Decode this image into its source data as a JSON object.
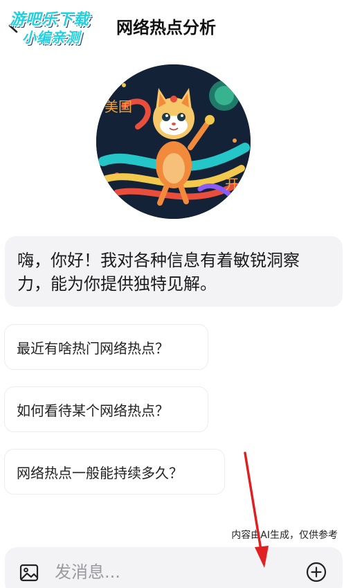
{
  "header": {
    "title": "网络热点分析",
    "back_icon": "chevron-left-icon",
    "watermark": {
      "line1": "游吧乐下载",
      "line2": "小编亲测"
    }
  },
  "avatar": {
    "description_icon": "cat-mascot-avatar",
    "text_left": "美国",
    "text_right": "开"
  },
  "greeting": {
    "text": "嗨，你好！我对各种信息有着敏锐洞察力，能为你提供独特见解。"
  },
  "suggestions": [
    {
      "label": "最近有啥热门网络热点？"
    },
    {
      "label": "如何看待某个网络热点？"
    },
    {
      "label": "网络热点一般能持续多久？"
    }
  ],
  "disclaimer": "内容由AI生成，仅供参考",
  "input": {
    "placeholder": "发消息...",
    "value": "",
    "image_icon": "image-icon",
    "plus_icon": "plus-circle-icon"
  },
  "colors": {
    "watermark": "#1fd0e0",
    "bubble_bg": "#f3f3f5",
    "annotation_arrow": "#e02020"
  }
}
